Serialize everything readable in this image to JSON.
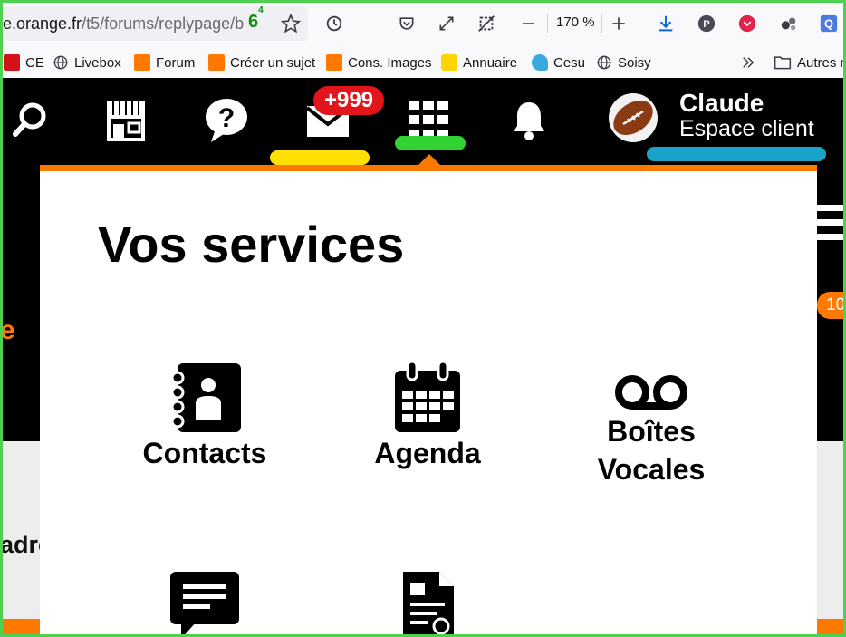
{
  "browser": {
    "url_domain": "e.orange.fr",
    "url_path": "/t5/forums/replypage/b",
    "tracker_count": "6",
    "tracker_sup_top": "4",
    "tracker_sup_bottom": "6",
    "zoom": "170 %"
  },
  "bookmarks": [
    {
      "label": "CE",
      "icon": "ce-favicon"
    },
    {
      "label": "Livebox",
      "icon": "globe-icon"
    },
    {
      "label": "Forum",
      "icon": "orange-favicon"
    },
    {
      "label": "Créer un sujet",
      "icon": "orange-favicon"
    },
    {
      "label": "Cons. Images",
      "icon": "orange-favicon"
    },
    {
      "label": "Annuaire",
      "icon": "smiley-favicon"
    },
    {
      "label": "Cesu",
      "icon": "cesu-favicon"
    },
    {
      "label": "Soisy",
      "icon": "globe-icon"
    },
    {
      "label": "Autres m",
      "icon": "folder-icon"
    }
  ],
  "nav": {
    "mail_badge": "+999",
    "user_name": "Claude",
    "user_subtitle": "Espace client",
    "side_badge": "10",
    "left_fragment": "e",
    "partial_text": "adre"
  },
  "panel": {
    "title": "Vos services",
    "services": [
      {
        "label": "Contacts",
        "icon": "contacts-book-icon"
      },
      {
        "label": "Agenda",
        "icon": "calendar-icon"
      },
      {
        "label": "Boîtes Vocales",
        "icon": "voicemail-icon"
      },
      {
        "label": "",
        "icon": "sms-message-icon"
      },
      {
        "label": "",
        "icon": "document-user-icon"
      }
    ]
  },
  "colors": {
    "orange": "#ff7900",
    "badge_red": "#e3151c",
    "pill_yellow": "#ffe000",
    "pill_green": "#32d232",
    "pill_blue": "#1aa3c8",
    "frame_green": "#4fd14f"
  }
}
